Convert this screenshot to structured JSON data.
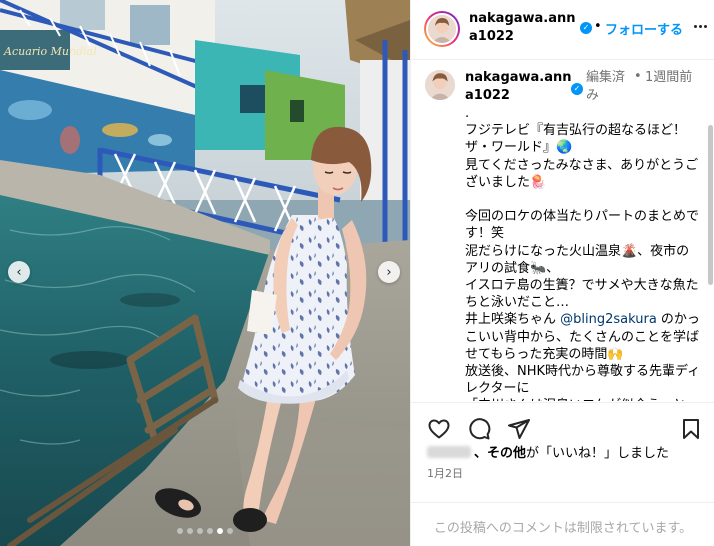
{
  "post": {
    "username": "nakagawa.anna1022",
    "verified_mark": "✓",
    "separator": "•",
    "follow_label": "フォローする",
    "more_icon": "ellipsis-icon"
  },
  "media": {
    "mural_sign": "Acuario Mundial",
    "prev_arrow": "‹",
    "next_arrow": "›",
    "carousel_count": 6,
    "carousel_active_index": 4
  },
  "caption": {
    "username": "nakagawa.anna1022",
    "verified_mark": "✓",
    "edited": "編集済み",
    "dot": "•",
    "time_ago": "1週間前",
    "text_part1": ".\nフジテレビ『有吉弘行の超なるほど！ザ・ワールド』🌏\n見てくださったみなさま、ありがとうございました🪼\n\n今回のロケの体当たりパートのまとめです！笑\n泥だらけになった火山温泉🌋、夜市のアリの試食🐜、\nイスロテ島の生簀？でサメや大きな魚たちと泳いだこと…\n井上咲楽ちゃん ",
    "mention": "@bling2sakura",
    "text_part2": " のかっこいい背中から、たくさんのことを学ばせてもらった充実の時間🙌\n放送後、NHK時代から尊敬する先輩ディレクターに\n「中川さんは泥臭いロケが似合う」と\n言われ、嬉しかったです。また全力で"
  },
  "likes": {
    "liked_by_suffix": "、その他",
    "liked_text": "が「いいね！」しました"
  },
  "date": "1月2日",
  "comments_restricted": "この投稿へのコメントは制限されています。",
  "colors": {
    "accent_blue": "#0095f6",
    "secondary_text": "#737373",
    "mention": "#00376b",
    "divider": "#efefef"
  }
}
